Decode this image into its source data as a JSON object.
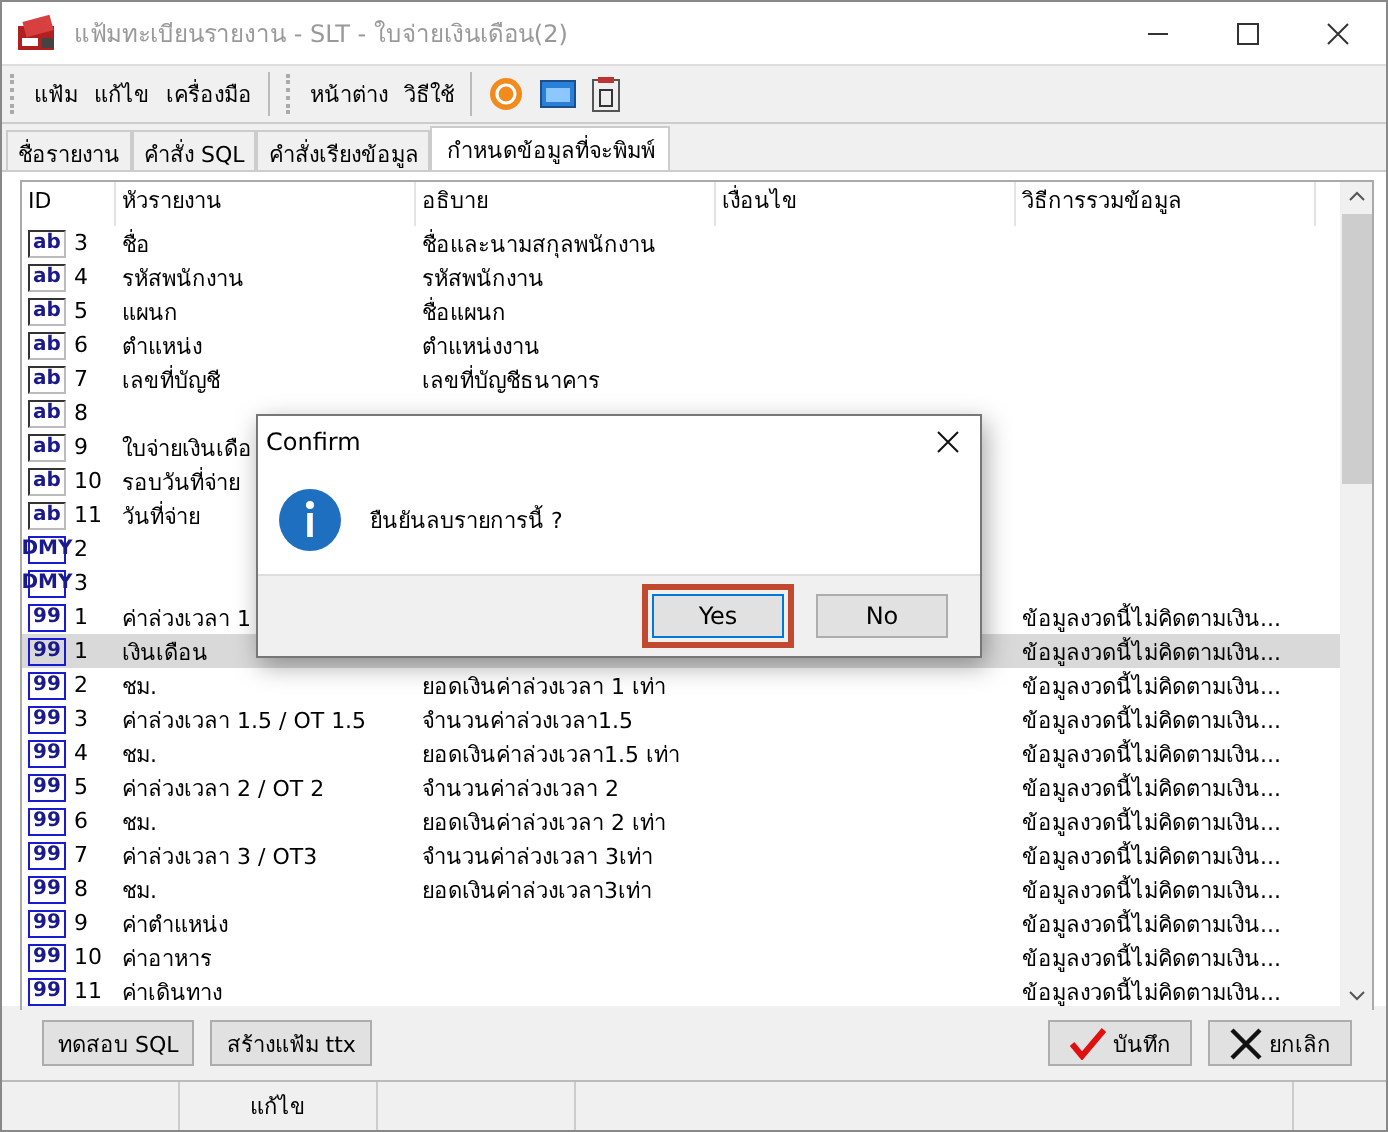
{
  "window": {
    "title": "แฟ้มทะเบียนรายงาน - SLT - ใบจ่ายเงินเดือน(2)"
  },
  "menu": [
    "แฟ้ม",
    "แก้ไข",
    "เครื่องมือ"
  ],
  "menu2": [
    "หน้าต่าง",
    "วิธีใช้"
  ],
  "tabs": [
    {
      "label": "ชื่อรายงาน",
      "selected": false
    },
    {
      "label": "คำสั่ง SQL",
      "selected": false
    },
    {
      "label": "คำสั่งเรียงข้อมูล",
      "selected": false
    },
    {
      "label": "กำหนดข้อมูลที่จะพิมพ์",
      "selected": true
    }
  ],
  "table": {
    "columns": [
      "ID",
      "หัวรายงาน",
      "อธิบาย",
      "เงื่อนไข",
      "วิธีการรวมข้อมูล"
    ],
    "rows": [
      {
        "kind": "text",
        "type_icon": "ab",
        "id": "3",
        "heading": "ชื่อ",
        "description": "ชื่อและนามสกุลพนักงาน",
        "selected": false
      },
      {
        "kind": "text",
        "type_icon": "ab",
        "id": "4",
        "heading": "รหัสพนักงาน",
        "description": "รหัสพนักงาน",
        "selected": false
      },
      {
        "kind": "text",
        "type_icon": "ab",
        "id": "5",
        "heading": "แผนก",
        "description": "ชื่อแผนก",
        "selected": false
      },
      {
        "kind": "text",
        "type_icon": "ab",
        "id": "6",
        "heading": "ตำแหน่ง",
        "description": "ตำแหน่งงาน",
        "selected": false
      },
      {
        "kind": "text",
        "type_icon": "ab",
        "id": "7",
        "heading": "เลขที่บัญชี",
        "description": "เลขที่บัญชีธนาคาร",
        "selected": false
      },
      {
        "kind": "text",
        "type_icon": "ab",
        "id": "8",
        "selected": false
      },
      {
        "kind": "text",
        "type_icon": "ab",
        "id": "9",
        "heading": "ใบจ่ายเงินเดือ",
        "selected": false
      },
      {
        "kind": "text",
        "type_icon": "ab",
        "id": "10",
        "heading": "รอบวันที่จ่าย",
        "selected": false
      },
      {
        "kind": "text",
        "type_icon": "ab",
        "id": "11",
        "heading": "วันที่จ่าย",
        "selected": false
      },
      {
        "kind": "date",
        "type_icon": "DMY",
        "id": "2",
        "selected": false
      },
      {
        "kind": "date",
        "type_icon": "DMY",
        "id": "3",
        "selected": false
      },
      {
        "kind": "number",
        "type_icon": "99",
        "id": "1",
        "heading": "ค่าล่วงเวลา 1",
        "method": "ข้อมูลงวดนี้ไม่คิดตามเงิน...",
        "selected": false
      },
      {
        "kind": "number",
        "type_icon": "99",
        "id": "1",
        "heading": "เงินเดือน",
        "method": "ข้อมูลงวดนี้ไม่คิดตามเงิน...",
        "selected": true
      },
      {
        "kind": "number",
        "type_icon": "99",
        "id": "2",
        "heading": "ชม.",
        "description": "ยอดเงินค่าล่วงเวลา 1 เท่า",
        "method": "ข้อมูลงวดนี้ไม่คิดตามเงิน...",
        "selected": false
      },
      {
        "kind": "number",
        "type_icon": "99",
        "id": "3",
        "heading": "ค่าล่วงเวลา 1.5 / OT 1.5",
        "description": "จำนวนค่าล่วงเวลา1.5",
        "method": "ข้อมูลงวดนี้ไม่คิดตามเงิน...",
        "selected": false
      },
      {
        "kind": "number",
        "type_icon": "99",
        "id": "4",
        "heading": "ชม.",
        "description": "ยอดเงินค่าล่วงเวลา1.5 เท่า",
        "method": "ข้อมูลงวดนี้ไม่คิดตามเงิน...",
        "selected": false
      },
      {
        "kind": "number",
        "type_icon": "99",
        "id": "5",
        "heading": "ค่าล่วงเวลา 2 / OT 2",
        "description": "จำนวนค่าล่วงเวลา 2",
        "method": "ข้อมูลงวดนี้ไม่คิดตามเงิน...",
        "selected": false
      },
      {
        "kind": "number",
        "type_icon": "99",
        "id": "6",
        "heading": "ชม.",
        "description": "ยอดเงินค่าล่วงเวลา 2 เท่า",
        "method": "ข้อมูลงวดนี้ไม่คิดตามเงิน...",
        "selected": false
      },
      {
        "kind": "number",
        "type_icon": "99",
        "id": "7",
        "heading": "ค่าล่วงเวลา 3 / OT3",
        "description": "จำนวนค่าล่วงเวลา 3เท่า",
        "method": "ข้อมูลงวดนี้ไม่คิดตามเงิน...",
        "selected": false
      },
      {
        "kind": "number",
        "type_icon": "99",
        "id": "8",
        "heading": "ชม.",
        "description": "ยอดเงินค่าล่วงเวลา3เท่า",
        "method": "ข้อมูลงวดนี้ไม่คิดตามเงิน...",
        "selected": false
      },
      {
        "kind": "number",
        "type_icon": "99",
        "id": "9",
        "heading": "ค่าตำแหน่ง",
        "method": "ข้อมูลงวดนี้ไม่คิดตามเงิน...",
        "selected": false
      },
      {
        "kind": "number",
        "type_icon": "99",
        "id": "10",
        "heading": "ค่าอาหาร",
        "method": "ข้อมูลงวดนี้ไม่คิดตามเงิน...",
        "selected": false
      },
      {
        "kind": "number",
        "type_icon": "99",
        "id": "11",
        "heading": "ค่าเดินทาง",
        "method": "ข้อมูลงวดนี้ไม่คิดตามเงิน...",
        "selected": false
      }
    ]
  },
  "dialog": {
    "title": "Confirm",
    "message": "ยืนยันลบรายการนี้ ?",
    "buttons": [
      {
        "label": "Yes",
        "highlighted": true
      },
      {
        "label": "No",
        "highlighted": false
      }
    ]
  },
  "left_buttons": [
    "ทดสอบ SQL",
    "สร้างแฟ้ม ttx"
  ],
  "save_button": "บันทึก",
  "cancel_button": "ยกเลิก",
  "status_bar": {
    "mode": "แก้ไข"
  }
}
